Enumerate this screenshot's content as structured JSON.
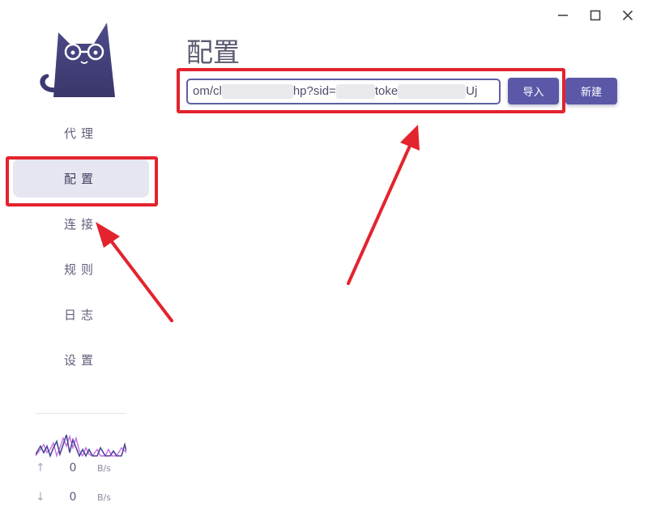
{
  "window": {
    "minimize_icon": "minimize-icon",
    "maximize_icon": "maximize-icon",
    "close_icon": "close-icon"
  },
  "sidebar": {
    "logo_icon": "cat-logo-icon",
    "items": [
      {
        "label": "代理"
      },
      {
        "label": "配置",
        "active": true
      },
      {
        "label": "连接"
      },
      {
        "label": "规则"
      },
      {
        "label": "日志"
      },
      {
        "label": "设置"
      }
    ],
    "traffic": {
      "upload_icon": "arrow-up-icon",
      "download_icon": "arrow-down-icon",
      "upload_value": "0",
      "download_value": "0",
      "unit": "B/s",
      "graph_colors": [
        "#4b4796",
        "#c96ce6"
      ]
    }
  },
  "main": {
    "title": "配置",
    "url_input": {
      "part1": "om/cl",
      "part2": "hp?sid=",
      "part3": "toke",
      "part4": "Uj"
    },
    "import_label": "导入",
    "new_label": "新建"
  },
  "colors": {
    "accent": "#5b58a8",
    "active_nav_bg": "#e6e6f0",
    "annotation_red": "#e3232d"
  }
}
